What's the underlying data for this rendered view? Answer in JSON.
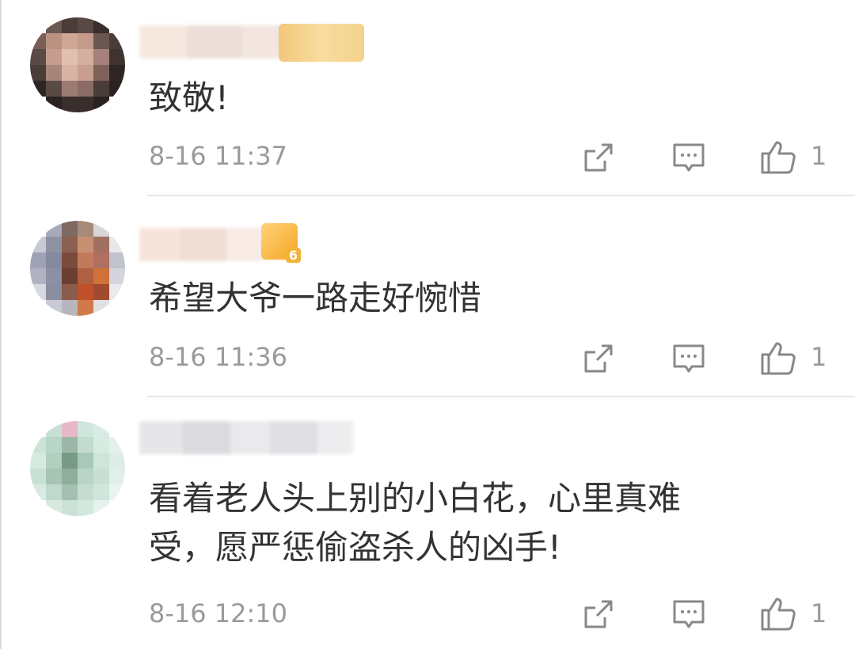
{
  "comments": [
    {
      "text": "致敬!",
      "time": "8-16 11:37",
      "likes": "1",
      "has_badge": true
    },
    {
      "text": "希望大爷一路走好惋惜",
      "time": "8-16 11:36",
      "likes": "1",
      "badge_level": "6"
    },
    {
      "text": "看着老人头上别的小白花，心里真难\n受，愿严惩偷盗杀人的凶手!",
      "time": "8-16 12:10",
      "likes": "1"
    }
  ],
  "icons": {
    "share": "share-icon",
    "reply": "comment-icon",
    "like": "thumbs-up-icon"
  },
  "colors": {
    "text": "#333333",
    "meta": "#9a9a9a",
    "icon": "#888888",
    "divider": "#e6e6e6",
    "badge": "#f5a623"
  }
}
